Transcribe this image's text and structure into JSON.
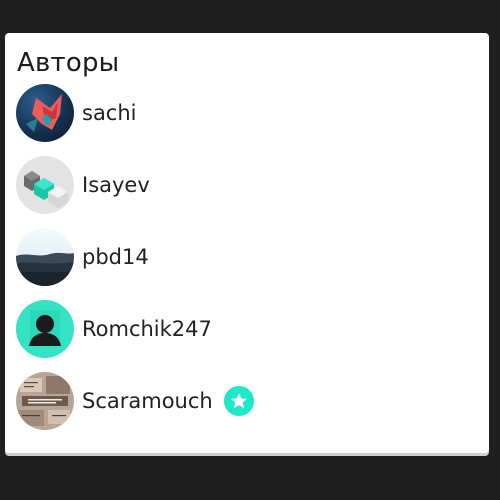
{
  "section": {
    "title": "Авторы"
  },
  "authors": [
    {
      "name": "sachi",
      "avatar": "fox-art-avatar-icon"
    },
    {
      "name": "Isayev",
      "avatar": "cubes-avatar-icon"
    },
    {
      "name": "pbd14",
      "avatar": "landscape-avatar-icon"
    },
    {
      "name": "Romchik247",
      "avatar": "default-user-avatar-icon"
    },
    {
      "name": "Scaramouch",
      "avatar": "text-collage-avatar-icon",
      "badge": "star-icon"
    }
  ],
  "colors": {
    "accent": "#1de9c7",
    "background": "#1f1f1f",
    "card": "#ffffff"
  }
}
